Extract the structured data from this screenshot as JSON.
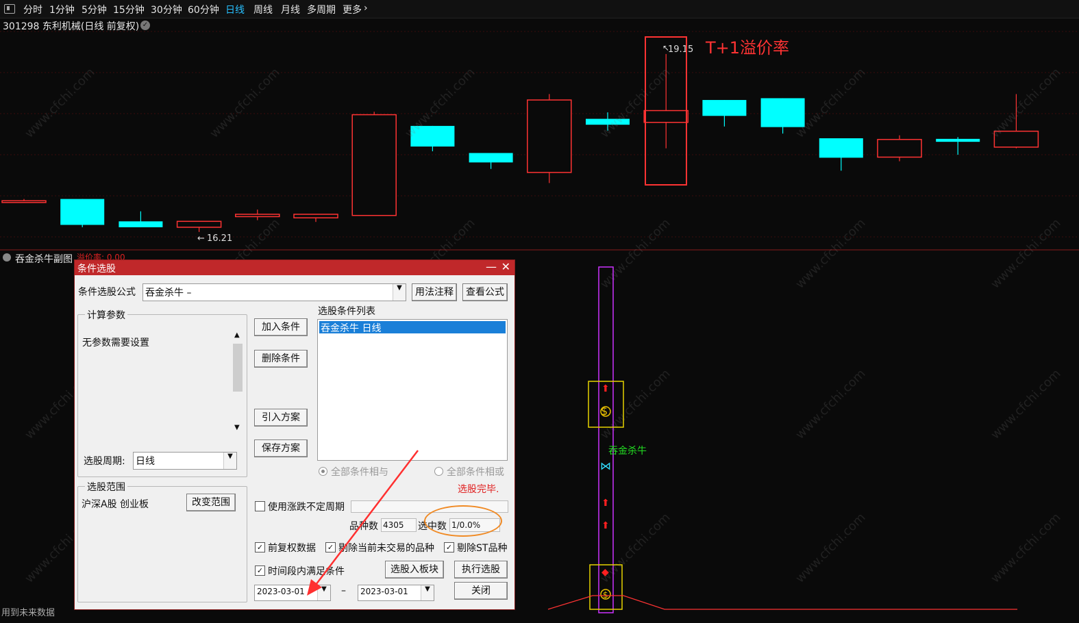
{
  "toolbar": {
    "tabs": [
      "分时",
      "1分钟",
      "5分钟",
      "15分钟",
      "30分钟",
      "60分钟",
      "日线",
      "周线",
      "月线",
      "多周期",
      "更多"
    ],
    "active": "日线",
    "more_icon": "chevron-right-icon"
  },
  "chart": {
    "stock_title": "301298 东利机械(日线 前复权)",
    "high_label": "19.15",
    "low_label": "16.21",
    "annotation": "T+1溢价率",
    "watermark": "www.cfchi.com",
    "colors": {
      "up": "#ff3333",
      "down": "#00ffff",
      "annotation": "#ff3333"
    }
  },
  "chart_data": {
    "type": "candlestick",
    "title": "301298 东利机械(日线 前复权)",
    "candles": [
      {
        "o": 16.63,
        "c": 16.66,
        "h": 16.69,
        "l": 16.63
      },
      {
        "o": 16.69,
        "c": 16.25,
        "h": 16.69,
        "l": 16.21
      },
      {
        "o": 16.31,
        "c": 16.21,
        "h": 16.48,
        "l": 16.21
      },
      {
        "o": 16.21,
        "c": 16.31,
        "h": 16.31,
        "l": 16.13
      },
      {
        "o": 16.39,
        "c": 16.43,
        "h": 16.51,
        "l": 16.33
      },
      {
        "o": 16.37,
        "c": 16.43,
        "h": 16.43,
        "l": 16.3
      },
      {
        "o": 16.41,
        "c": 18.12,
        "h": 18.17,
        "l": 16.41
      },
      {
        "o": 17.93,
        "c": 17.58,
        "h": 17.93,
        "l": 17.5
      },
      {
        "o": 17.47,
        "c": 17.31,
        "h": 17.47,
        "l": 17.2
      },
      {
        "o": 17.14,
        "c": 18.37,
        "h": 18.47,
        "l": 16.96
      },
      {
        "o": 18.05,
        "c": 17.95,
        "h": 18.16,
        "l": 17.85
      },
      {
        "o": 17.99,
        "c": 18.19,
        "h": 19.15,
        "l": 17.55
      },
      {
        "o": 18.37,
        "c": 18.1,
        "h": 18.37,
        "l": 17.92
      },
      {
        "o": 18.4,
        "c": 17.91,
        "h": 18.4,
        "l": 17.8
      },
      {
        "o": 17.72,
        "c": 17.39,
        "h": 17.72,
        "l": 17.17
      },
      {
        "o": 17.4,
        "c": 17.7,
        "h": 17.77,
        "l": 17.33
      },
      {
        "o": 17.71,
        "c": 17.66,
        "h": 17.74,
        "l": 17.44
      },
      {
        "o": 17.57,
        "c": 17.84,
        "h": 18.47,
        "l": 17.55
      }
    ],
    "highlight_index": 11,
    "ylim": [
      16.0,
      19.3
    ]
  },
  "sub_chart": {
    "title": "吞金杀牛副图",
    "premium_label": "溢价率: 0.00",
    "signal_label": "吞金杀牛",
    "bottom_label": "用到未来数据",
    "money_icon": "money-bag-icon",
    "butterfly_icon": "butterfly-icon",
    "arrow_icon": "arrow-up-icon"
  },
  "dialog": {
    "title": "条件选股",
    "formula_label": "条件选股公式",
    "formula_value": "吞金杀牛   –",
    "usage_btn": "用法注释",
    "view_btn": "查看公式",
    "params_group": "计算参数",
    "no_params": "无参数需要设置",
    "period_label": "选股周期:",
    "period_value": "日线",
    "range_group": "选股范围",
    "range_value": "沪深A股 创业板",
    "change_range_btn": "改变范围",
    "add_btn": "加入条件",
    "delete_btn": "删除条件",
    "import_btn": "引入方案",
    "save_btn": "保存方案",
    "list_label": "选股条件列表",
    "list_items": [
      "吞金杀牛   日线"
    ],
    "radio_and": "全部条件相与",
    "radio_or": "全部条件相或",
    "status": "选股完毕.",
    "use_period": "使用涨跌不定周期",
    "count_label": "品种数",
    "count_value": "4305",
    "hit_label": "选中数",
    "hit_value": "1/0.0%",
    "chk_prerights": "前复权数据",
    "chk_exclude_untraded": "剔除当前未交易的品种",
    "chk_exclude_st": "剔除ST品种",
    "chk_time_range": "时间段内满足条件",
    "to_block_btn": "选股入板块",
    "run_btn": "执行选股",
    "close_btn": "关闭",
    "date_from": "2023-03-01",
    "date_to": "2023-03-01",
    "date_sep": "–"
  }
}
